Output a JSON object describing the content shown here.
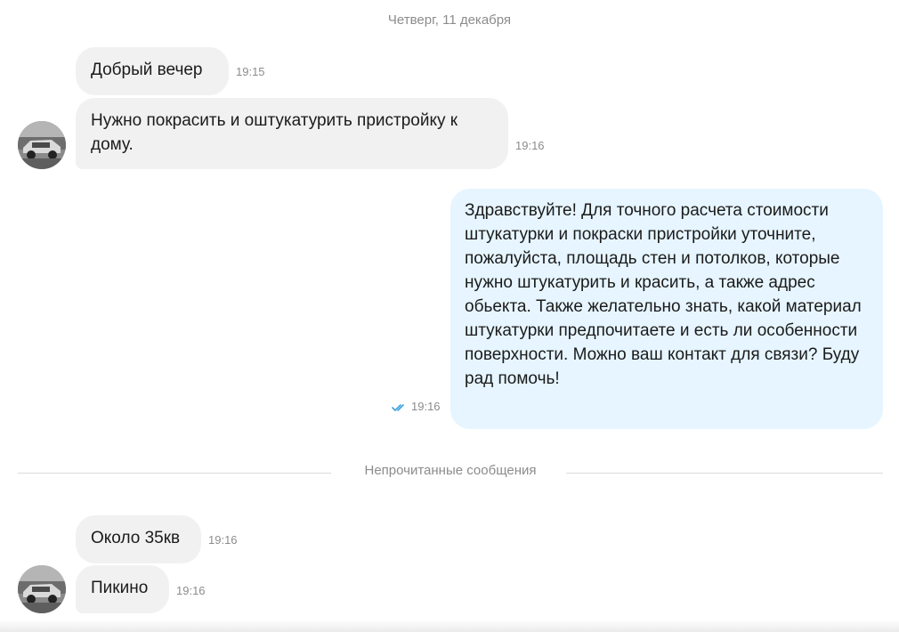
{
  "date_separator": "Четверг, 11 декабря",
  "messages": [
    {
      "direction": "in",
      "text": "Добрый вечер",
      "time": "19:15"
    },
    {
      "direction": "in",
      "text": "Нужно покрасить и оштукатурить пристройку к дому.",
      "time": "19:16"
    },
    {
      "direction": "out",
      "text": "Здравствуйте! Для точного расчета стоимости штукатурки и покраски пристройки уточните, пожалуйста, площадь стен и потолков, которые нужно штукатурить и красить, а также адрес обьекта. Также желательно знать, какой материал штукатурки предпочитаете и есть ли особенности поверхности. Можно ваш контакт для связи? Буду рад помочь!",
      "time": "19:16",
      "status": "read"
    },
    {
      "direction": "in",
      "text": "Около 35кв",
      "time": "19:16"
    },
    {
      "direction": "in",
      "text": "Пикино",
      "time": "19:16"
    }
  ],
  "unread_separator": "Непрочитанные сообщения",
  "colors": {
    "incoming_bubble": "#f1f1f1",
    "outgoing_bubble": "#e6f5ff",
    "read_check": "#3aa0e0"
  },
  "icons": {
    "avatar": "car-photo-avatar",
    "read_status": "double-check-icon"
  }
}
